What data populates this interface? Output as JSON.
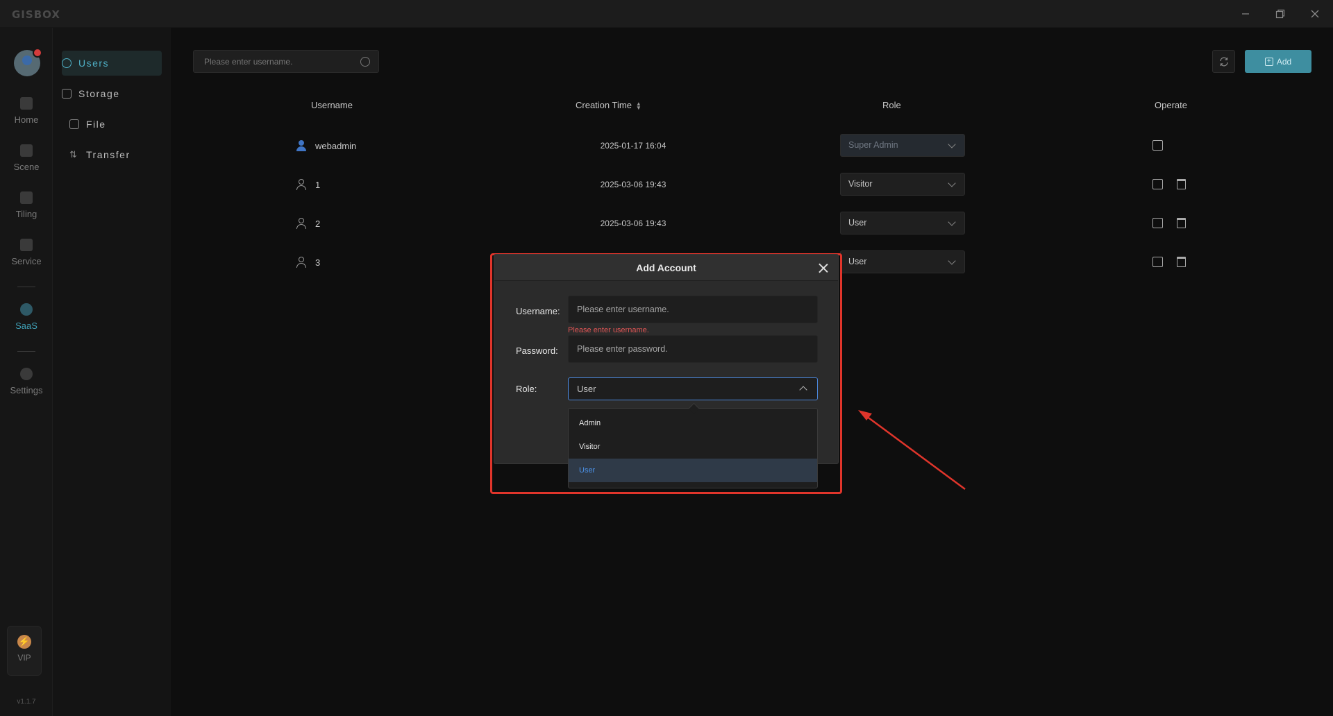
{
  "app": {
    "logo": "GISBOX"
  },
  "rail": {
    "items": [
      {
        "label": "Home"
      },
      {
        "label": "Scene"
      },
      {
        "label": "Tiling"
      },
      {
        "label": "Service"
      },
      {
        "label": "SaaS"
      },
      {
        "label": "Settings"
      }
    ],
    "vip": "VIP",
    "version": "v1.1.7"
  },
  "subnav": {
    "items": [
      {
        "label": "Users"
      },
      {
        "label": "Storage"
      },
      {
        "label": "File"
      },
      {
        "label": "Transfer"
      }
    ]
  },
  "toolbar": {
    "search_placeholder": "Please enter username.",
    "add_label": "Add"
  },
  "table": {
    "headers": {
      "username": "Username",
      "creation_time": "Creation Time",
      "role": "Role",
      "operate": "Operate"
    },
    "rows": [
      {
        "username": "webadmin",
        "time": "2025-01-17 16:04",
        "role": "Super Admin"
      },
      {
        "username": "1",
        "time": "2025-03-06 19:43",
        "role": "Visitor"
      },
      {
        "username": "2",
        "time": "2025-03-06 19:43",
        "role": "User"
      },
      {
        "username": "3",
        "time": "",
        "role": "User"
      }
    ]
  },
  "modal": {
    "title": "Add Account",
    "username_label": "Username:",
    "username_placeholder": "Please enter username.",
    "username_error": "Please enter username.",
    "password_label": "Password:",
    "password_placeholder": "Please enter password.",
    "role_label": "Role:",
    "role_value": "User",
    "role_options": [
      "Admin",
      "Visitor",
      "User"
    ]
  },
  "colors": {
    "accent": "#3e8ea0",
    "annotation": "#e0352b",
    "selected_option": "#4c93ea"
  }
}
